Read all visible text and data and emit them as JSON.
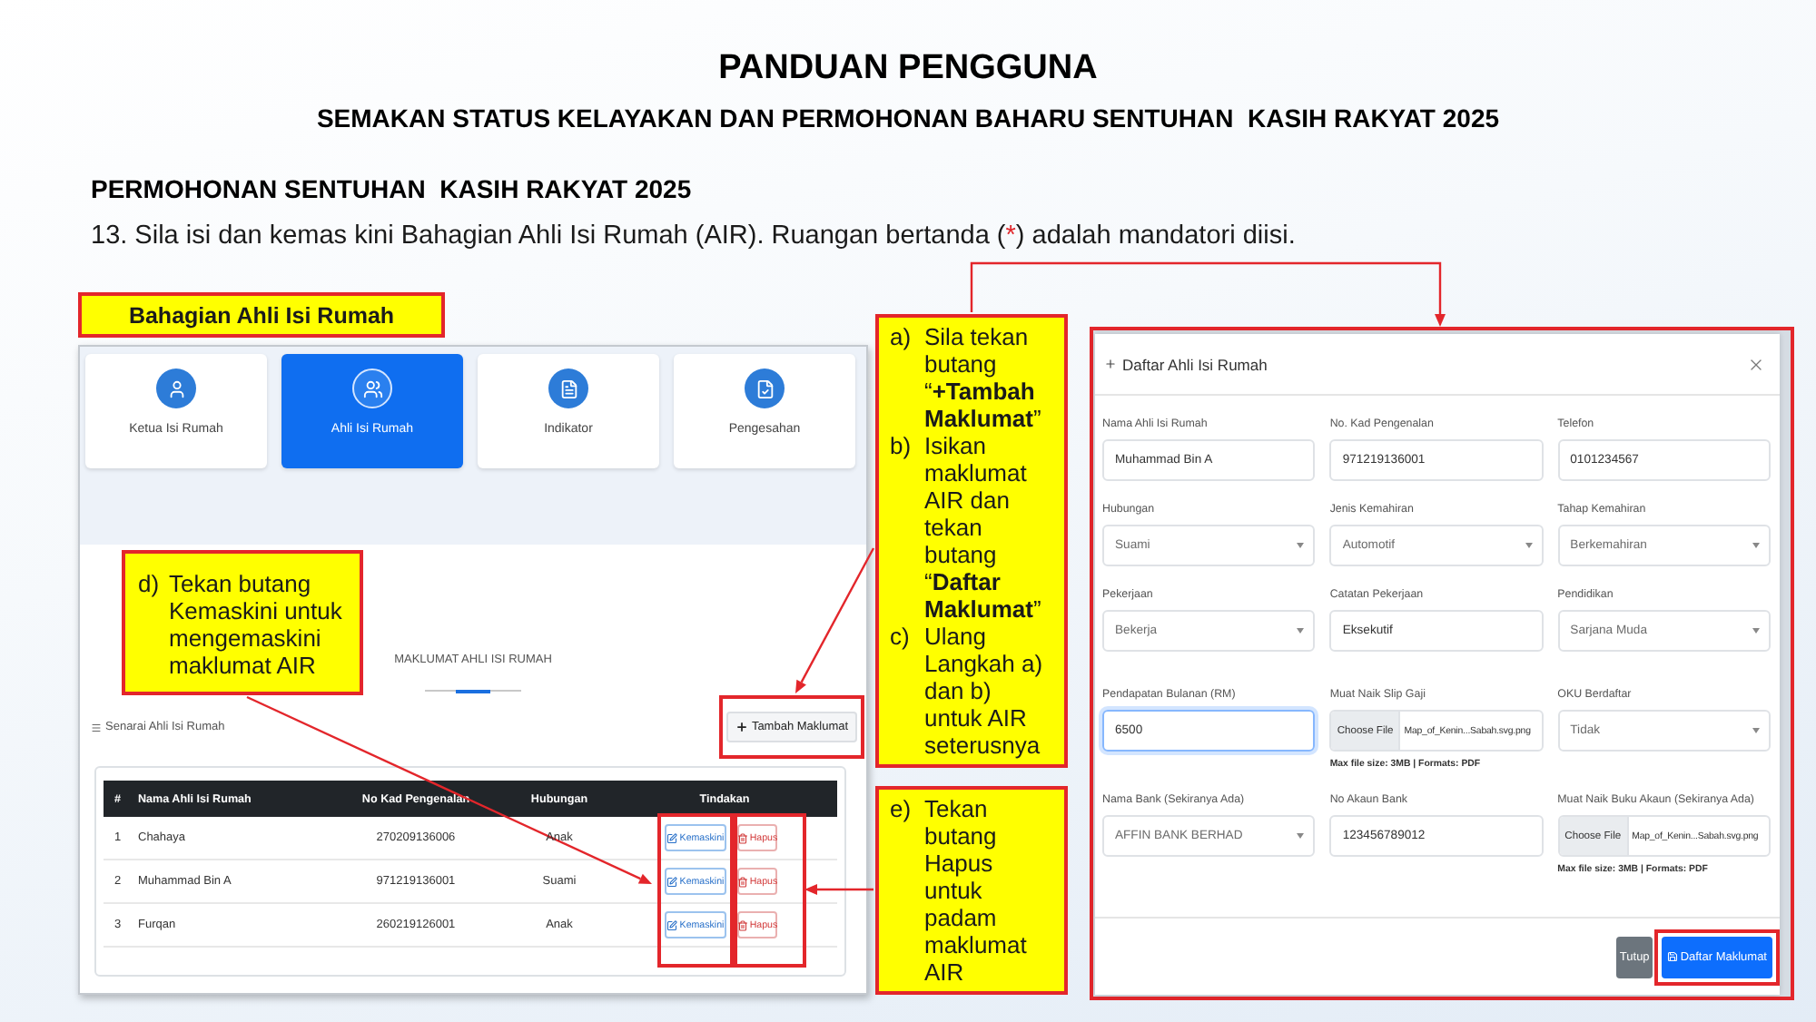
{
  "header": {
    "title": "PANDUAN PENGGUNA",
    "subtitle": "SEMAKAN STATUS KELAYAKAN DAN PERMOHONAN BAHARU SENTUHAN  KASIH RAKYAT 2025"
  },
  "section": {
    "heading": "PERMOHONAN SENTUHAN  KASIH RAKYAT 2025",
    "instruction": [
      {
        "kind": "plain",
        "text": "13. Sila isi dan kemas kini Bahagian Ahli Isi Rumah (AIR). Ruangan bertanda ("
      },
      {
        "kind": "required",
        "text": "*"
      },
      {
        "kind": "plain",
        "text": ") adalah mandatori diisi."
      }
    ]
  },
  "left_panel": {
    "label": "Bahagian Ahli Isi Rumah",
    "steps": [
      {
        "label": "Ketua Isi Rumah",
        "selected": false
      },
      {
        "label": "Ahli Isi Rumah",
        "selected": true
      },
      {
        "label": "Indikator",
        "selected": false
      },
      {
        "label": "Pengesahan",
        "selected": false
      }
    ],
    "list_title": "MAKLUMAT AHLI ISI RUMAH",
    "list_caption": "Senarai Ahli Isi Rumah",
    "add_button": "Tambah Maklumat",
    "table": {
      "columns": [
        "#",
        "Nama Ahli Isi Rumah",
        "No Kad Pengenalan",
        "Hubungan",
        "Tindakan"
      ],
      "rows": [
        {
          "cells": [
            "1",
            "Chahaya",
            "270209136006",
            "Anak"
          ],
          "actions": [
            {
              "kind": "edit",
              "label": "Kemaskini"
            },
            {
              "kind": "delete",
              "label": "Hapus"
            }
          ]
        },
        {
          "cells": [
            "2",
            "Muhammad Bin A",
            "971219136001",
            "Suami"
          ],
          "actions": [
            {
              "kind": "edit",
              "label": "Kemaskini"
            },
            {
              "kind": "delete",
              "label": "Hapus"
            }
          ]
        },
        {
          "cells": [
            "3",
            "Furqan",
            "260219126001",
            "Anak"
          ],
          "actions": [
            {
              "kind": "edit",
              "label": "Kemaskini"
            },
            {
              "kind": "delete",
              "label": "Hapus"
            }
          ]
        }
      ]
    },
    "callout": {
      "marker": "d)",
      "text": "Tekan butang Kemaskini untuk mengemaskini maklumat AIR"
    }
  },
  "callouts": [
    {
      "items": [
        {
          "marker": "a)",
          "text": "Sila tekan butang “**+Tambah Maklumat**”"
        },
        {
          "marker": "b)",
          "text": "Isikan maklumat AIR dan tekan butang “**Daftar Maklumat**”"
        },
        {
          "marker": "c)",
          "text": "Ulang Langkah a) dan b) untuk AIR seterusnya"
        }
      ]
    },
    {
      "items": [
        {
          "marker": "e)",
          "text": "Tekan butang Hapus untuk padam maklumat AIR"
        }
      ]
    }
  ],
  "dialog": {
    "title": "Daftar Ahli Isi Rumah",
    "fields": [
      {
        "label": "Nama Ahli Isi Rumah",
        "kind": "text",
        "value": "Muhammad Bin A",
        "focused": false
      },
      {
        "label": "No. Kad Pengenalan",
        "kind": "text",
        "value": "971219136001",
        "focused": false
      },
      {
        "label": "Telefon",
        "kind": "text",
        "value": "0101234567",
        "focused": false
      },
      {
        "label": "Hubungan",
        "kind": "select",
        "value": "Suami",
        "focused": false
      },
      {
        "label": "Jenis Kemahiran",
        "kind": "select",
        "value": "Automotif",
        "focused": false
      },
      {
        "label": "Tahap Kemahiran",
        "kind": "select",
        "value": "Berkemahiran",
        "focused": false
      },
      {
        "label": "Pekerjaan",
        "kind": "select",
        "value": "Bekerja",
        "focused": false
      },
      {
        "label": "Catatan Pekerjaan",
        "kind": "text",
        "value": "Eksekutif",
        "focused": false
      },
      {
        "label": "Pendidikan",
        "kind": "select",
        "value": "Sarjana Muda",
        "focused": false
      },
      {
        "label": "Pendapatan Bulanan (RM)",
        "kind": "text",
        "value": "6500",
        "focused": true
      },
      {
        "label": "Muat Naik Slip Gaji",
        "kind": "file",
        "button": "Choose File",
        "value": "Map_of_Kenin...Sabah.svg.png",
        "help": "Max file size: 3MB | Formats: PDF",
        "focused": false
      },
      {
        "label": "OKU Berdaftar",
        "kind": "select",
        "value": "Tidak",
        "focused": false
      },
      {
        "label": "Nama Bank (Sekiranya Ada)",
        "kind": "select",
        "value": "AFFIN BANK BERHAD",
        "focused": false
      },
      {
        "label": "No Akaun Bank",
        "kind": "text",
        "value": "123456789012",
        "focused": false
      },
      {
        "label": "Muat Naik Buku Akaun (Sekiranya Ada)",
        "kind": "file",
        "button": "Choose File",
        "value": "Map_of_Kenin...Sabah.svg.png",
        "help": "Max file size: 3MB | Formats: PDF",
        "focused": false
      }
    ],
    "buttons": [
      {
        "kind": "secondary",
        "label": "Tutup"
      },
      {
        "kind": "primary",
        "label": "Daftar Maklumat"
      }
    ]
  }
}
